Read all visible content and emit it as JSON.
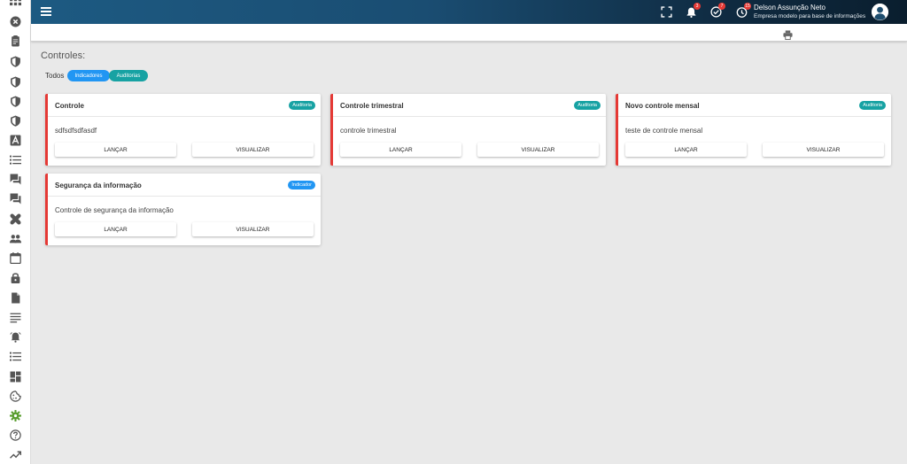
{
  "topbar": {
    "notifications_badge": "3",
    "tasks_badge": "7",
    "timer_badge": "15",
    "user_name": "Delson Assunção Neto",
    "user_company": "Empresa modelo para base de informações"
  },
  "main": {
    "title": "Controles:",
    "filters": {
      "all_label": "Todos",
      "indicadores_label": "Indicadores",
      "auditorias_label": "Auditorias"
    },
    "cards": [
      {
        "title": "Controle",
        "tag": "Auditoria",
        "description": "sdfsdfsdfasdf",
        "launch_label": "LANÇAR",
        "view_label": "VISUALIZAR"
      },
      {
        "title": "Controle trimestral",
        "tag": "Auditoria",
        "description": "controle trimestral",
        "launch_label": "LANÇAR",
        "view_label": "VISUALIZAR"
      },
      {
        "title": "Novo controle mensal",
        "tag": "Auditoria",
        "description": "teste de controle mensal",
        "launch_label": "LANÇAR",
        "view_label": "VISUALIZAR"
      },
      {
        "title": "Segurança da informação",
        "tag": "Indicador",
        "description": "Controle de segurança da informação",
        "launch_label": "LANÇAR",
        "view_label": "VISUALIZAR"
      }
    ]
  },
  "colors": {
    "accent_blue": "#2196f3",
    "accent_teal": "#17a2a3",
    "card_border": "#e53935",
    "settings_icon": "#5a9e2f"
  }
}
